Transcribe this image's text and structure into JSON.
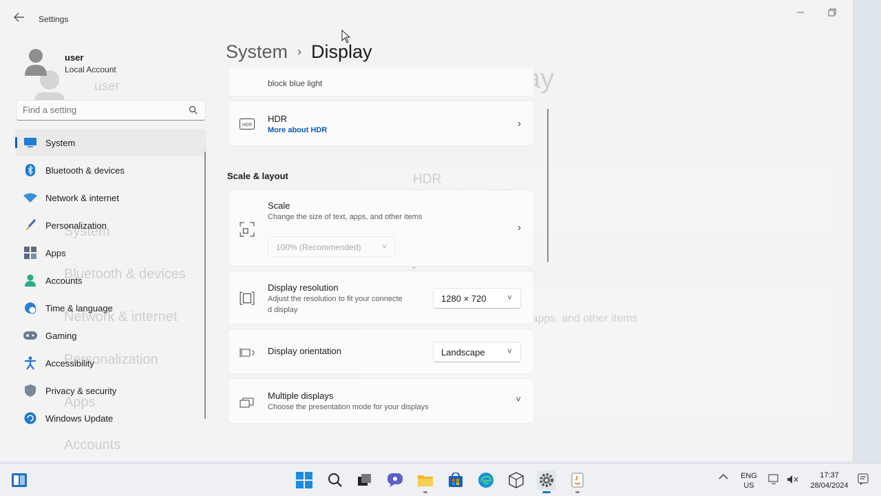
{
  "window": {
    "title": "Settings"
  },
  "profile": {
    "name": "user",
    "account_type": "Local Account"
  },
  "search": {
    "placeholder": "Find a setting"
  },
  "nav": [
    {
      "label": "System",
      "icon": "system-icon",
      "active": true
    },
    {
      "label": "Bluetooth & devices",
      "icon": "bluetooth-icon"
    },
    {
      "label": "Network & internet",
      "icon": "wifi-icon"
    },
    {
      "label": "Personalization",
      "icon": "brush-icon"
    },
    {
      "label": "Apps",
      "icon": "apps-icon"
    },
    {
      "label": "Accounts",
      "icon": "person-icon"
    },
    {
      "label": "Time & language",
      "icon": "globe-clock-icon"
    },
    {
      "label": "Gaming",
      "icon": "gamepad-icon"
    },
    {
      "label": "Accessibility",
      "icon": "accessibility-icon"
    },
    {
      "label": "Privacy & security",
      "icon": "shield-icon"
    },
    {
      "label": "Windows Update",
      "icon": "update-icon"
    }
  ],
  "breadcrumb": {
    "parent": "System",
    "separator": "›",
    "current": "Display"
  },
  "night_light": {
    "subtitle": "block blue light"
  },
  "hdr": {
    "title": "HDR",
    "link": "More about HDR",
    "icon": "hdr-icon"
  },
  "scale_layout": {
    "heading": "Scale & layout",
    "scale": {
      "title": "Scale",
      "subtitle": "Change the size of text, apps, and other items",
      "value": "100% (Recommended)"
    },
    "resolution": {
      "title": "Display resolution",
      "subtitle_line1": "Adjust the resolution to fit your connecte",
      "subtitle_line2": "d display",
      "value": "1280 × 720"
    },
    "orientation": {
      "title": "Display orientation",
      "value": "Landscape"
    },
    "multiple": {
      "title": "Multiple displays",
      "subtitle": "Choose the presentation mode for your displays"
    }
  },
  "taskbar": {
    "apps": [
      "start-icon",
      "search-icon",
      "task-view-icon",
      "chat-icon",
      "file-explorer-icon",
      "store-icon",
      "edge-icon",
      "app-package-icon",
      "settings-icon",
      "java-icon"
    ],
    "language": {
      "line1": "ENG",
      "line2": "US"
    },
    "clock": {
      "time": "17:37",
      "date": "28/04/2024"
    }
  },
  "colors": {
    "accent": "#005fb8",
    "link": "#0a5bb0",
    "window_bg": "#f3f3f3"
  }
}
